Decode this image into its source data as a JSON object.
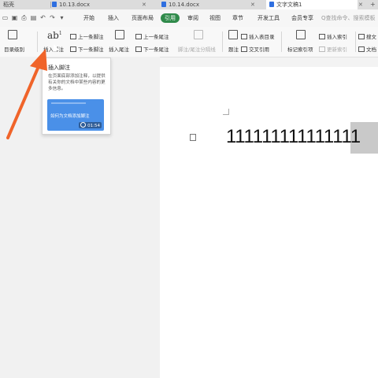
{
  "tabs": [
    {
      "label": "稻壳",
      "active": false
    },
    {
      "label": "10.13.docx",
      "active": false
    },
    {
      "label": "10.14.docx",
      "active": false
    },
    {
      "label": "文字文稿1",
      "active": true
    }
  ],
  "menu": {
    "items": [
      "开始",
      "插入",
      "页面布局",
      "引用",
      "审阅",
      "视图",
      "章节",
      "开发工具",
      "会员专享"
    ],
    "active": "引用",
    "search_placeholder": "Q查找命令、搜索模板"
  },
  "ribbon": {
    "toc_label": "目录级别",
    "insert_footnote": "插入脚注",
    "prev_footnote": "上一条脚注",
    "next_footnote": "下一条脚注",
    "insert_endnote": "插入尾注",
    "prev_endnote": "上一条尾注",
    "next_endnote": "下一条尾注",
    "footnote_separator": "脚注/尾注分隔线",
    "caption": "题注",
    "insert_table_of_figures": "插入表目录",
    "cross_reference": "交叉引用",
    "mark_index_entry": "标记索引项",
    "insert_index": "插入索引",
    "update_index": "更新索引",
    "citation": "搜文",
    "document": "文档"
  },
  "tooltip": {
    "title": "插入脚注",
    "description": "在页面底部添加注释，以提供有关你的文档中某些内容的更多信息。",
    "video_title": "如何为文档添加脚注",
    "video_duration": "01:54"
  },
  "document": {
    "text": "111111111111111"
  },
  "colors": {
    "accent": "#2f8a4a",
    "arrow": "#f0642a",
    "video": "#4a90e8"
  }
}
